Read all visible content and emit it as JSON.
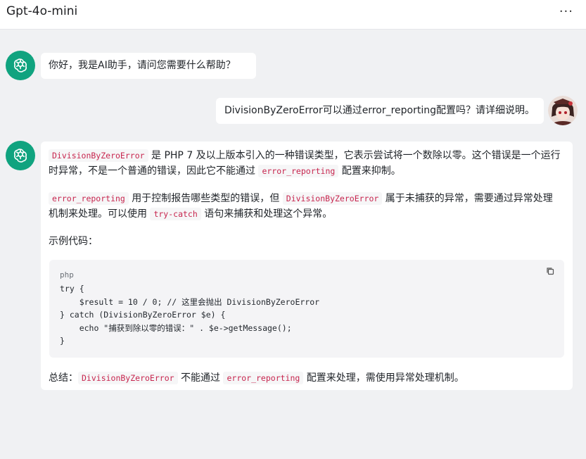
{
  "header": {
    "title": "Gpt-4o-mini",
    "menu_icon": "more-horizontal-icon",
    "menu_glyph": "···"
  },
  "messages": {
    "bot_greeting": "你好，我是AI助手，请问您需要什么帮助？",
    "user_question": "DivisionByZeroError可以通过error_reporting配置吗？请详细说明。",
    "answer": {
      "p1_code1": "DivisionByZeroError",
      "p1_text1": " 是 PHP 7 及以上版本引入的一种错误类型，它表示尝试将一个数除以零。这个错误是一个运行时异常，不是一个普通的错误，因此它不能通过 ",
      "p1_code2": "error_reporting",
      "p1_text2": " 配置来抑制。",
      "p2_code1": "error_reporting",
      "p2_text1": " 用于控制报告哪些类型的错误，但 ",
      "p2_code2": "DivisionByZeroError",
      "p2_text2": " 属于未捕获的异常，需要通过异常处理机制来处理。可以使用 ",
      "p2_code3": "try-catch",
      "p2_text3": " 语句来捕获和处理这个异常。",
      "p3_text": "示例代码：",
      "code_lang": "php",
      "code_block": "try {\n    $result = 10 / 0; // 这里会抛出 DivisionByZeroError\n} catch (DivisionByZeroError $e) {\n    echo \"捕获到除以零的错误：\" . $e->getMessage();\n}",
      "p4_text1": "总结：",
      "p4_code1": "DivisionByZeroError",
      "p4_text2": " 不能通过 ",
      "p4_code2": "error_reporting",
      "p4_text3": " 配置来处理，需使用异常处理机制。"
    }
  },
  "colors": {
    "bot_avatar": "#10a37f",
    "inline_code": "#c7254e",
    "background": "#f0f1f3"
  }
}
